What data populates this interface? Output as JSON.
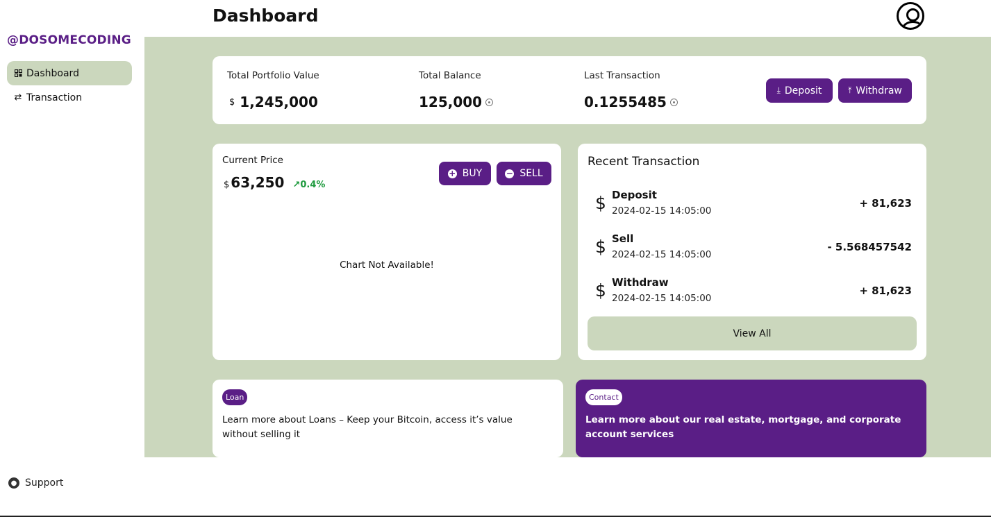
{
  "brand": "@DOSOMECODING",
  "sidebar": {
    "items": [
      {
        "label": "Dashboard",
        "icon": "dashboard-grid-icon",
        "active": true
      },
      {
        "label": "Transaction",
        "icon": "swap-arrows-icon",
        "active": false
      }
    ],
    "support": "Support"
  },
  "header": {
    "title": "Dashboard"
  },
  "summary": {
    "portfolio_label": "Total Portfolio Value",
    "portfolio_currency": "$",
    "portfolio_value": "1,245,000",
    "balance_label": "Total Balance",
    "balance_value": "125,000",
    "last_label": "Last Transaction",
    "last_value": "0.1255485",
    "deposit_label": "Deposit",
    "withdraw_label": "Withdraw"
  },
  "price": {
    "label": "Current Price",
    "currency": "$",
    "value": "63,250",
    "change": "0.4%",
    "buy_label": "BUY",
    "sell_label": "SELL",
    "chart_message": "Chart Not Available!"
  },
  "recent": {
    "title": "Recent Transaction",
    "items": [
      {
        "name": "Deposit",
        "date": "2024-02-15 14:05:00",
        "amount": "+ 81,623"
      },
      {
        "name": "Sell",
        "date": "2024-02-15 14:05:00",
        "amount": "- 5.568457542"
      },
      {
        "name": "Withdraw",
        "date": "2024-02-15 14:05:00",
        "amount": "+ 81,623"
      }
    ],
    "view_all": "View All"
  },
  "loan": {
    "tag": "Loan",
    "text": "Learn more about Loans – Keep your Bitcoin, access it’s value without selling it"
  },
  "contact": {
    "tag": "Contact",
    "text": "Learn more about our real estate, mortgage, and corporate account services"
  },
  "colors": {
    "primary": "#5a1e86",
    "background": "#cbd7bd",
    "positive": "#1e9a3e"
  }
}
